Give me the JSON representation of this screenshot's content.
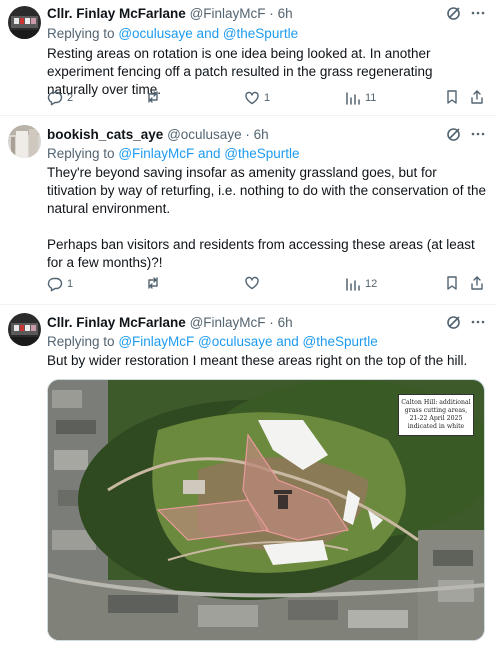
{
  "tweets": [
    {
      "name": "Cllr. Finlay McFarlane",
      "handle": "@FinlayMcF",
      "time": "6h",
      "reply_prefix": "Replying to",
      "reply_links": "@oculusaye and @theSpurtle",
      "text": [
        "Resting areas on rotation is one idea being looked at. In another experiment fencing off a patch resulted in the grass regenerating naturally over time."
      ],
      "stats": {
        "replies": "2",
        "retweets": "",
        "likes": "1",
        "views": "11"
      }
    },
    {
      "name": "bookish_cats_aye",
      "handle": "@oculusaye",
      "time": "6h",
      "reply_prefix": "Replying to",
      "reply_links": "@FinlayMcF and @theSpurtle",
      "text": [
        "They're beyond saving insofar as amenity grassland goes, but for titivation by way of returfing, i.e. nothing to do with the conservation of the natural environment.",
        "Perhaps ban visitors and residents from accessing these areas (at least for a few months)?!"
      ],
      "stats": {
        "replies": "1",
        "retweets": "",
        "likes": "",
        "views": "12"
      }
    },
    {
      "name": "Cllr. Finlay McFarlane",
      "handle": "@FinlayMcF",
      "time": "6h",
      "reply_prefix": "Replying to",
      "reply_links": "@FinlayMcF @oculusaye and @theSpurtle",
      "text": [
        "But by wider restoration I meant these areas right on the top of the hill."
      ],
      "media": {
        "legend_lines": [
          "Calton Hill: additional",
          "grass cutting areas,",
          "21-22 April 2025",
          "indicated in white"
        ]
      }
    }
  ],
  "icons": {
    "reply": "reply-icon",
    "retweet": "retweet-icon",
    "like": "heart-icon",
    "views": "views-icon",
    "bookmark": "bookmark-icon",
    "share": "share-icon",
    "grok": "grok-icon",
    "more": "more-icon"
  },
  "colors": {
    "link": "#1d9bf0",
    "secondary": "#536471",
    "text": "#0f1419",
    "divider": "#eff3f4"
  }
}
